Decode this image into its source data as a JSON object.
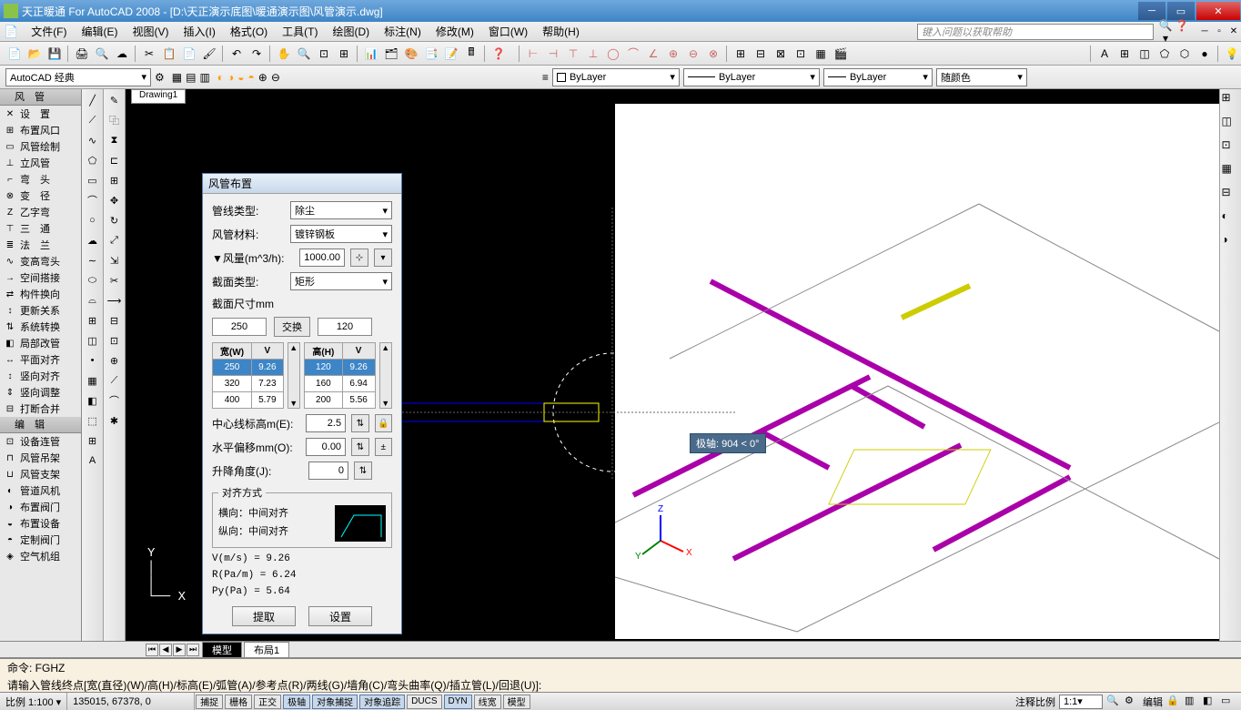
{
  "title": "天正暖通 For AutoCAD 2008 - [D:\\天正演示底图\\暖通演示图\\风管演示.dwg]",
  "menu": [
    "文件(F)",
    "编辑(E)",
    "视图(V)",
    "插入(I)",
    "格式(O)",
    "工具(T)",
    "绘图(D)",
    "标注(N)",
    "修改(M)",
    "窗口(W)",
    "帮助(H)"
  ],
  "help_placeholder": "键入问题以获取帮助",
  "style_dropdown": "AutoCAD 经典",
  "layer_dd": "ByLayer",
  "linetype_dd": "ByLayer",
  "lineweight_dd": "ByLayer",
  "color_dd": "随颜色",
  "left_panel_items": [
    {
      "icon": "≡",
      "label": "风　管",
      "hdr": true
    },
    {
      "icon": "✕",
      "label": "设　置"
    },
    {
      "icon": "⊞",
      "label": "布置风口"
    },
    {
      "icon": "▭",
      "label": "风管绘制"
    },
    {
      "icon": "⊥",
      "label": "立风管"
    },
    {
      "icon": "⌐",
      "label": "弯　头"
    },
    {
      "icon": "⊗",
      "label": "变　径"
    },
    {
      "icon": "Z",
      "label": "乙字弯"
    },
    {
      "icon": "⊤",
      "label": "三　通"
    },
    {
      "icon": "≣",
      "label": "法　兰"
    },
    {
      "icon": "∿",
      "label": "变高弯头"
    },
    {
      "icon": "→",
      "label": "空间搭接"
    },
    {
      "icon": "⇄",
      "label": "构件换向"
    },
    {
      "icon": "↕",
      "label": "更新关系"
    },
    {
      "icon": "⇅",
      "label": "系统转换"
    },
    {
      "icon": "◧",
      "label": "局部改管"
    },
    {
      "icon": "↔",
      "label": "平面对齐"
    },
    {
      "icon": "↕",
      "label": "竖向对齐"
    },
    {
      "icon": "⇕",
      "label": "竖向调整"
    },
    {
      "icon": "⊟",
      "label": "打断合并"
    },
    {
      "icon": "▶",
      "label": "编　辑",
      "hdr": true
    },
    {
      "icon": "⊡",
      "label": "设备连管"
    },
    {
      "icon": "⊓",
      "label": "风管吊架"
    },
    {
      "icon": "⊔",
      "label": "风管支架"
    },
    {
      "icon": "◐",
      "label": "管道风机"
    },
    {
      "icon": "◑",
      "label": "布置阀门"
    },
    {
      "icon": "◒",
      "label": "布置设备"
    },
    {
      "icon": "◓",
      "label": "定制阀门"
    },
    {
      "icon": "◈",
      "label": "空气机组"
    }
  ],
  "drawing_tab": "Drawing1",
  "dialog": {
    "title": "风管布置",
    "pipe_type_label": "管线类型:",
    "pipe_type_value": "除尘",
    "material_label": "风管材料:",
    "material_value": "镀锌钢板",
    "flow_label": "▼风量(m^3/h):",
    "flow_value": "1000.00",
    "section_type_label": "截面类型:",
    "section_type_value": "矩形",
    "section_dim_label": "截面尺寸mm",
    "width_value": "250",
    "swap_label": "交换",
    "height_value": "120",
    "width_hdr_w": "宽(W)",
    "width_hdr_v": "V",
    "height_hdr_h": "高(H)",
    "height_hdr_v": "V",
    "width_rows": [
      [
        "250",
        "9.26"
      ],
      [
        "320",
        "7.23"
      ],
      [
        "400",
        "5.79"
      ]
    ],
    "height_rows": [
      [
        "120",
        "9.26"
      ],
      [
        "160",
        "6.94"
      ],
      [
        "200",
        "5.56"
      ]
    ],
    "center_elev_label": "中心线标高m(E):",
    "center_elev_value": "2.5",
    "offset_label": "水平偏移mm(O):",
    "offset_value": "0.00",
    "angle_label": "升降角度(J):",
    "angle_value": "0",
    "align_legend": "对齐方式",
    "align_h": "横向：中间对齐",
    "align_v": "纵向：中间对齐",
    "calc_v": "V(m/s) = 9.26",
    "calc_r": "R(Pa/m) = 6.24",
    "calc_py": "Py(Pa) = 5.64",
    "btn_extract": "提取",
    "btn_set": "设置"
  },
  "polar_tooltip": "极轴: 904 < 0°",
  "bottom_tabs": {
    "model": "模型",
    "layout": "布局1"
  },
  "cmd1": "命令: FGHZ",
  "cmd2": "请输入管线终点[宽(直径)(W)/高(H)/标高(E)/弧管(A)/参考点(R)/两线(G)/墙角(C)/弯头曲率(Q)/插立管(L)/回退(U)]:",
  "status": {
    "scale": "比例 1:100 ▾",
    "coords": "135015, 67378, 0",
    "toggles": [
      "捕捉",
      "栅格",
      "正交",
      "极轴",
      "对象捕捉",
      "对象追踪",
      "DUCS",
      "DYN",
      "线宽",
      "模型"
    ],
    "toggle_on": [
      false,
      false,
      false,
      true,
      true,
      true,
      false,
      true,
      false,
      false
    ],
    "anno": "注释比例",
    "anno_val": "1:1"
  }
}
